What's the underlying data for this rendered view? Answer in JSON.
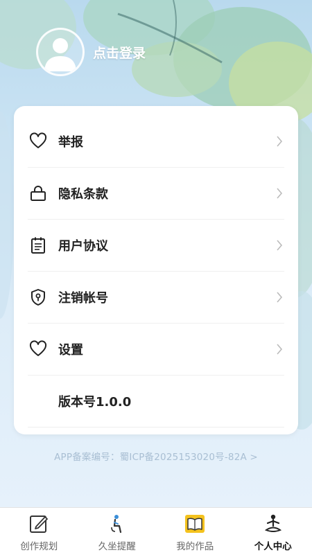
{
  "header": {
    "login_label": "点击登录"
  },
  "menu": {
    "items": [
      {
        "label": "举报",
        "icon": "heart-icon"
      },
      {
        "label": "隐私条款",
        "icon": "lock-icon"
      },
      {
        "label": "用户协议",
        "icon": "notepad-icon"
      },
      {
        "label": "注销帐号",
        "icon": "shield-key-icon"
      },
      {
        "label": "设置",
        "icon": "heart-icon"
      }
    ],
    "version": "版本号1.0.0"
  },
  "icp": {
    "text": "APP备案编号：蜀ICP备2025153020号-82A >"
  },
  "tabbar": {
    "tabs": [
      {
        "label": "创作规划",
        "icon": "pen-note-icon"
      },
      {
        "label": "久坐提醒",
        "icon": "sitting-person-icon"
      },
      {
        "label": "我的作品",
        "icon": "book-icon"
      },
      {
        "label": "个人中心",
        "icon": "meditation-person-icon",
        "active": true
      }
    ]
  },
  "colors": {
    "accent": "#222222",
    "card": "#ffffff",
    "muted": "#a9bfd3"
  }
}
